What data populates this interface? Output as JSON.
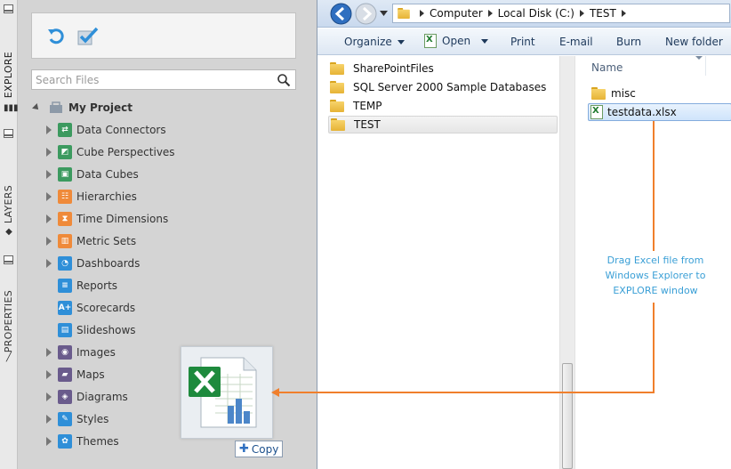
{
  "side_tabs": {
    "explore": "EXPLORE",
    "layers": "LAYERS",
    "properties": "PROPERTIES"
  },
  "explore": {
    "search_placeholder": "Search Files",
    "project": "My Project",
    "items": [
      {
        "label": "Data Connectors",
        "icon": "data-connectors-icon",
        "color": "#3c9a5f",
        "expandable": true
      },
      {
        "label": "Cube Perspectives",
        "icon": "cube-perspectives-icon",
        "color": "#3c9a5f",
        "expandable": true
      },
      {
        "label": "Data Cubes",
        "icon": "data-cubes-icon",
        "color": "#3c9a5f",
        "expandable": true
      },
      {
        "label": "Hierarchies",
        "icon": "hierarchies-icon",
        "color": "#ef8a3a",
        "expandable": true
      },
      {
        "label": "Time Dimensions",
        "icon": "time-dimensions-icon",
        "color": "#ef8a3a",
        "expandable": true
      },
      {
        "label": "Metric Sets",
        "icon": "metric-sets-icon",
        "color": "#ef8a3a",
        "expandable": true
      },
      {
        "label": "Dashboards",
        "icon": "dashboards-icon",
        "color": "#2f8fd8",
        "expandable": true
      },
      {
        "label": "Reports",
        "icon": "reports-icon",
        "color": "#2f8fd8",
        "expandable": false
      },
      {
        "label": "Scorecards",
        "icon": "scorecards-icon",
        "color": "#2f8fd8",
        "expandable": false
      },
      {
        "label": "Slideshows",
        "icon": "slideshows-icon",
        "color": "#2f8fd8",
        "expandable": false
      },
      {
        "label": "Images",
        "icon": "images-icon",
        "color": "#6a5b8c",
        "expandable": true
      },
      {
        "label": "Maps",
        "icon": "maps-icon",
        "color": "#6a5b8c",
        "expandable": true
      },
      {
        "label": "Diagrams",
        "icon": "diagrams-icon",
        "color": "#6a5b8c",
        "expandable": true
      },
      {
        "label": "Styles",
        "icon": "styles-icon",
        "color": "#2f8fd8",
        "expandable": true
      },
      {
        "label": "Themes",
        "icon": "themes-icon",
        "color": "#2f8fd8",
        "expandable": true
      }
    ]
  },
  "drag": {
    "copy_label": "Copy"
  },
  "windows_explorer": {
    "breadcrumb": [
      "Computer",
      "Local Disk (C:)",
      "TEST"
    ],
    "commands": {
      "organize": "Organize",
      "open": "Open",
      "print": "Print",
      "email": "E-mail",
      "burn": "Burn",
      "new_folder": "New folder"
    },
    "nav_folders": [
      "SharePointFiles",
      "SQL Server 2000 Sample Databases",
      "TEMP",
      "TEST"
    ],
    "column_name": "Name",
    "files": [
      {
        "name": "misc",
        "type": "folder"
      },
      {
        "name": "testdata.xlsx",
        "type": "xlsx"
      }
    ]
  },
  "annotation": {
    "lines": [
      "Drag Excel file from",
      "Windows Explorer to",
      "EXPLORE window"
    ],
    "color": "#f07f2c"
  }
}
